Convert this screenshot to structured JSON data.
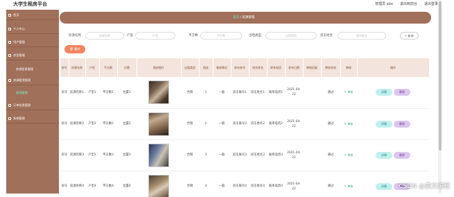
{
  "header": {
    "title": "大学生租房平台",
    "admin": "管理员 abo",
    "exit_frontend": "退出到前台",
    "logout": "退出登录"
  },
  "sidebar": {
    "items": [
      {
        "label": "首页"
      },
      {
        "label": "个人中心"
      },
      {
        "label": "用户管理"
      },
      {
        "label": "房型管理"
      },
      {
        "label": "房源信息管理"
      },
      {
        "label": "房源租赁管理"
      },
      {
        "label": "房源管理"
      },
      {
        "label": "订单信息管理"
      },
      {
        "label": "系统管理"
      }
    ]
  },
  "breadcrumb": {
    "home": "首页",
    "current": "房源管理"
  },
  "search": {
    "fields": [
      {
        "label": "房源名称",
        "placeholder": "房源名称"
      },
      {
        "label": "户型",
        "placeholder": "户型"
      },
      {
        "label": "平方数",
        "placeholder": "平方数"
      },
      {
        "label": "出租类型",
        "placeholder": "出租类型"
      },
      {
        "label": "房东姓名",
        "placeholder": "房东姓名"
      }
    ],
    "search_label": "查询"
  },
  "toolbar": {
    "delete_label": "删除"
  },
  "table": {
    "headers": [
      "房号",
      "房源名称",
      "户型",
      "平方数",
      "位置",
      "租房图片",
      "出租类型",
      "租金",
      "装修情况",
      "房东账号",
      "房东姓名",
      "联系电话",
      "发布日期",
      "审核回复",
      "审核状态",
      "审核",
      "操作"
    ],
    "rows": [
      {
        "no": "房号",
        "name": "房源名称1",
        "type": "户型1",
        "area": "平方数1",
        "loc": "位置1",
        "rent_type": "合租",
        "rent": "1",
        "deco": "一般",
        "acc": "房东账号1",
        "owner": "房东姓名1",
        "phone": "联系电话1",
        "date": "2021-04-22",
        "reply": "",
        "status": "通过",
        "audit": "审核",
        "detail": "详情",
        "del": "删除"
      },
      {
        "no": "房号",
        "name": "房源名称2",
        "type": "户型2",
        "area": "平方数2",
        "loc": "位置2",
        "rent_type": "合租",
        "rent": "2",
        "deco": "一般",
        "acc": "房东账号2",
        "owner": "房东姓名2",
        "phone": "联系电话2",
        "date": "2021-04-22",
        "reply": "",
        "status": "通过",
        "audit": "审核",
        "detail": "详情",
        "del": "删除"
      },
      {
        "no": "房号",
        "name": "房源名称3",
        "type": "户型3",
        "area": "平方数3",
        "loc": "位置3",
        "rent_type": "合租",
        "rent": "3",
        "deco": "一般",
        "acc": "房东账号3",
        "owner": "房东姓名3",
        "phone": "联系电话3",
        "date": "2021-04-22",
        "reply": "",
        "status": "通过",
        "audit": "审核",
        "detail": "详情",
        "del": "删除"
      },
      {
        "no": "房号",
        "name": "房源名称4",
        "type": "户型4",
        "area": "平方数4",
        "loc": "位置4",
        "rent_type": "合租",
        "rent": "4",
        "deco": "一般",
        "acc": "房东账号4",
        "owner": "房东姓名4",
        "phone": "联系电话4",
        "date": "2021-04-22",
        "reply": "",
        "status": "通过",
        "audit": "审核",
        "detail": "详情",
        "del": "删除"
      }
    ]
  },
  "watermark": "CSDN @黄文编程",
  "colors": {
    "sidebar": "#a1705a",
    "accent": "#6ff3cf",
    "delete": "#f4845f"
  }
}
